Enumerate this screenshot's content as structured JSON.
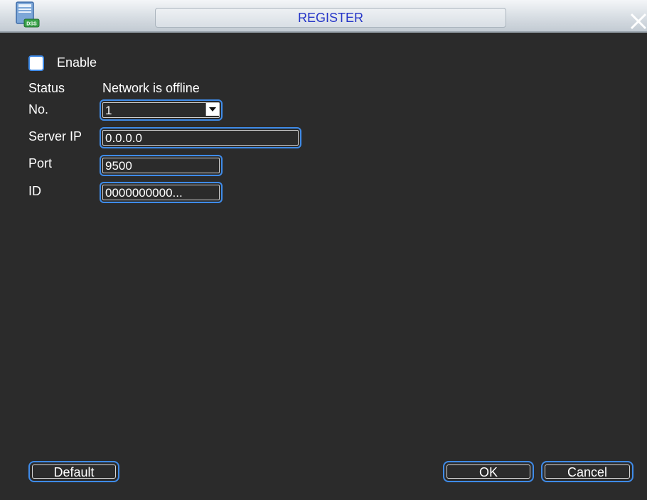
{
  "window": {
    "title": "REGISTER",
    "app_icon": "dss-icon",
    "app_icon_badge": "DSS"
  },
  "form": {
    "enable": {
      "label": "Enable",
      "checked": false
    },
    "status": {
      "label": "Status",
      "value": "Network is offline"
    },
    "number": {
      "label": "No.",
      "value": "1"
    },
    "server_ip": {
      "label": "Server IP",
      "value": "0.0.0.0"
    },
    "port": {
      "label": "Port",
      "value": "9500"
    },
    "id": {
      "label": "ID",
      "value": "0000000000..."
    }
  },
  "buttons": {
    "default": "Default",
    "ok": "OK",
    "cancel": "Cancel"
  },
  "colors": {
    "accent": "#3f8be8",
    "title_text": "#2535c8",
    "background": "#2b2b2b"
  }
}
